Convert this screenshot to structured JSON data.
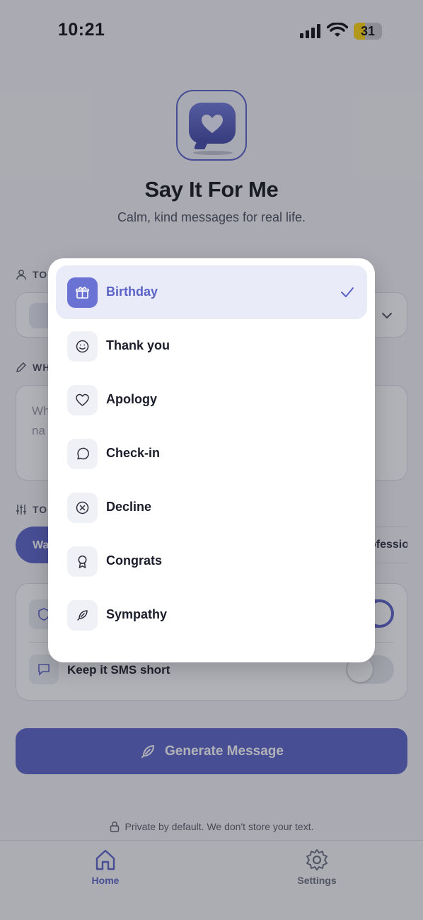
{
  "status_bar": {
    "time": "10:21",
    "battery": "31"
  },
  "header": {
    "app_name": "Say It For Me",
    "tagline": "Calm, kind messages for real life."
  },
  "form": {
    "to_label": "TO",
    "what_label": "WH",
    "what_placeholder": "Wh\nna",
    "tone_label": "TO",
    "tone_active": "Wa",
    "tone_other": "ofessio",
    "sms_short_label": "Keep it SMS short"
  },
  "generate_button": {
    "label": "Generate Message"
  },
  "privacy_note": "Private by default. We don't store your text.",
  "tabbar": {
    "home": "Home",
    "settings": "Settings"
  },
  "occasion_picker": {
    "selected": "Birthday",
    "options": [
      {
        "label": "Birthday",
        "icon": "gift-icon"
      },
      {
        "label": "Thank you",
        "icon": "smile-icon"
      },
      {
        "label": "Apology",
        "icon": "heart-icon"
      },
      {
        "label": "Check-in",
        "icon": "message-circle-icon"
      },
      {
        "label": "Decline",
        "icon": "x-circle-icon"
      },
      {
        "label": "Congrats",
        "icon": "award-icon"
      },
      {
        "label": "Sympathy",
        "icon": "feather-icon"
      }
    ]
  },
  "colors": {
    "accent": "#5b63c8",
    "selected_bg": "#e9ebf8",
    "overlay": "rgba(40,42,55,0.36)"
  }
}
